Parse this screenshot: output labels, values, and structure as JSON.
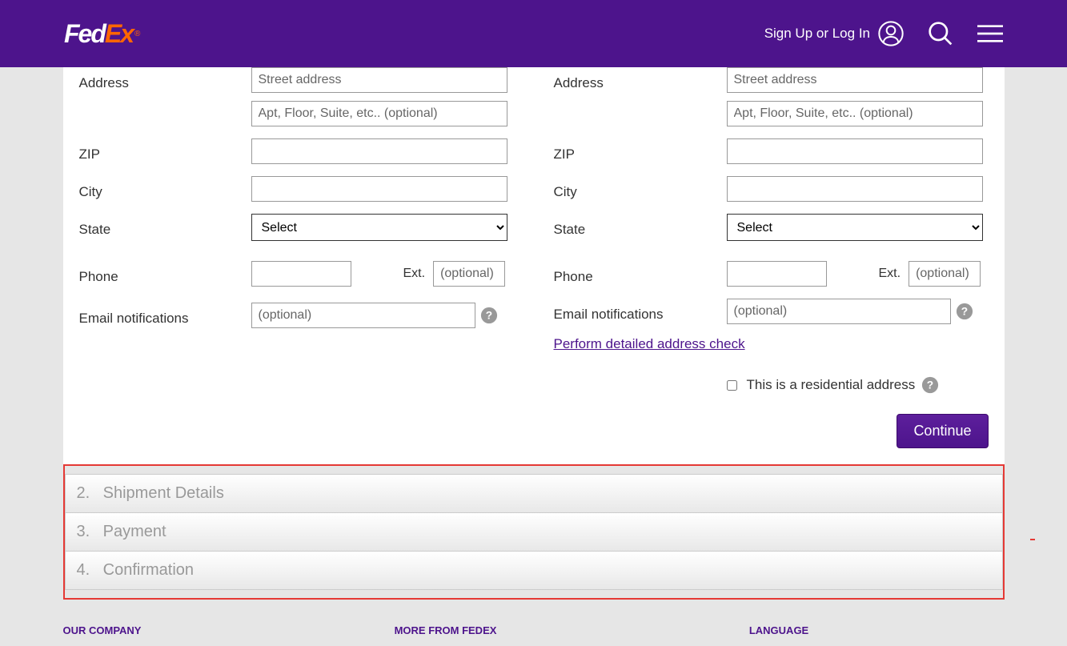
{
  "header": {
    "logo_fed": "Fed",
    "logo_ex": "Ex",
    "signup_login": "Sign Up or Log In"
  },
  "form": {
    "left": {
      "address_label": "Address",
      "street_placeholder": "Street address",
      "apt_placeholder": "Apt, Floor, Suite, etc.. (optional)",
      "zip_label": "ZIP",
      "city_label": "City",
      "state_label": "State",
      "state_select": "Select",
      "phone_label": "Phone",
      "ext_label": "Ext.",
      "ext_placeholder": "(optional)",
      "email_label": "Email notifications",
      "email_placeholder": "(optional)"
    },
    "right": {
      "address_label": "Address",
      "street_placeholder": "Street address",
      "apt_placeholder": "Apt, Floor, Suite, etc.. (optional)",
      "zip_label": "ZIP",
      "city_label": "City",
      "state_label": "State",
      "state_select": "Select",
      "phone_label": "Phone",
      "ext_label": "Ext.",
      "ext_placeholder": "(optional)",
      "email_label": "Email notifications",
      "email_placeholder": "(optional)",
      "address_check_link": "Perform detailed address check",
      "residential_label": "This is a residential address"
    },
    "continue_btn": "Continue"
  },
  "steps": [
    {
      "num": "2.",
      "title": "Shipment Details"
    },
    {
      "num": "3.",
      "title": "Payment"
    },
    {
      "num": "4.",
      "title": "Confirmation"
    }
  ],
  "footer": {
    "col1": "OUR COMPANY",
    "col2": "MORE FROM FEDEX",
    "col3": "LANGUAGE"
  }
}
